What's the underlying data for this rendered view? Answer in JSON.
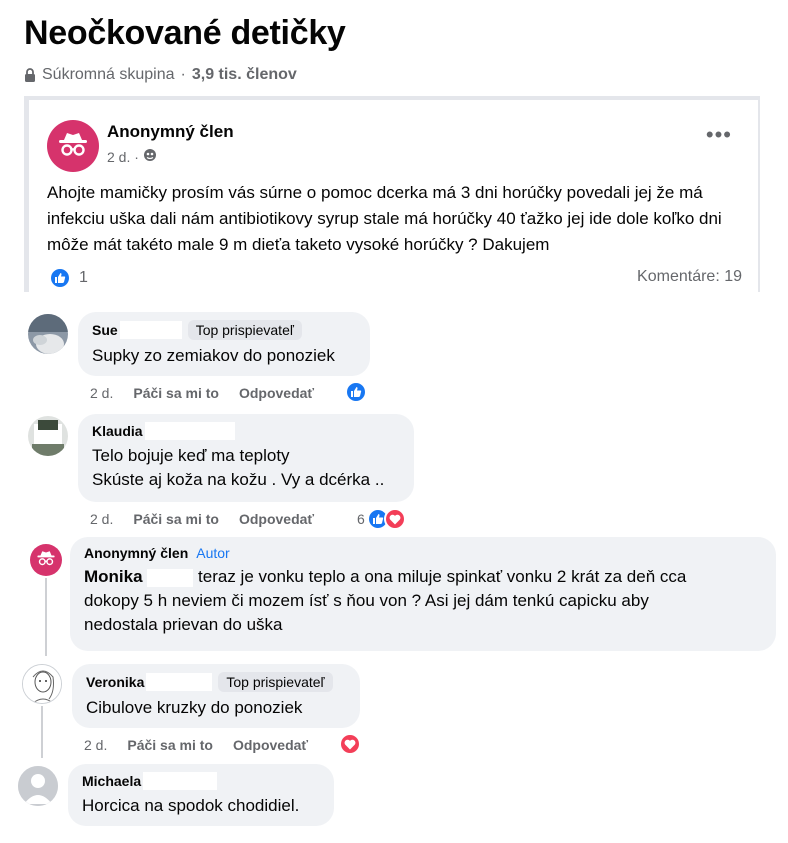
{
  "group": {
    "title": "Neočkované detičky",
    "privacy": "Súkromná skupina",
    "separator": "·",
    "members": "3,9 tis. členov"
  },
  "post": {
    "author": "Anonymný člen",
    "time": "2 d. ·",
    "text": "Ahojte mamičky prosím vás súrne o pomoc dcerka má 3 dni horúčky povedali jej že má infekciu uška dali nám antibiotikovy syrup stale má horúčky 40 ťažko jej ide dole koľko dni môže mát takéto male 9 m dieťa taketo vysoké horúčky ? Dakujem",
    "like_count": "1",
    "comments_label": "Komentáre: 19",
    "more_label": "•••"
  },
  "comments": [
    {
      "name": "Sue",
      "badge": "Top prispievateľ",
      "text": "Supky zo zemiakov do ponoziek",
      "time": "2 d.",
      "like_label": "Páči sa mi to",
      "reply_label": "Odpovedať"
    },
    {
      "name": "Klaudia",
      "text_line1": "Telo bojuje keď ma teploty",
      "text_line2": "Skúste aj koža na kožu . Vy a dcérka ..",
      "time": "2 d.",
      "like_label": "Páči sa mi to",
      "reply_label": "Odpovedať",
      "react_count": "6"
    },
    {
      "name": "Anonymný člen",
      "author_tag": "Autor",
      "mention": "Monika",
      "text_line1": "teraz je vonku teplo a ona miluje spinkať vonku 2 krát za deň cca",
      "text_line2": "dokopy 5 h neviem či mozem ísť s ňou von ? Asi jej dám tenkú capicku aby",
      "text_line3": "nedostala prievan do uška"
    },
    {
      "name": "Veronika",
      "badge": "Top prispievateľ",
      "text": "Cibulove kruzky do ponoziek",
      "time": "2 d.",
      "like_label": "Páči sa mi to",
      "reply_label": "Odpovedať"
    },
    {
      "name": "Michaela",
      "text": "Horcica na spodok chodidiel."
    }
  ],
  "colors": {
    "accent": "#1877f2",
    "heart": "#f33e58",
    "anon_avatar": "#d6336c",
    "bubble": "#f0f2f5",
    "secondary_text": "#65676b"
  },
  "icons": {
    "lock": "lock-icon",
    "globe": "globe-icon",
    "like": "like-icon",
    "heart": "heart-icon",
    "incognito": "incognito-icon"
  }
}
